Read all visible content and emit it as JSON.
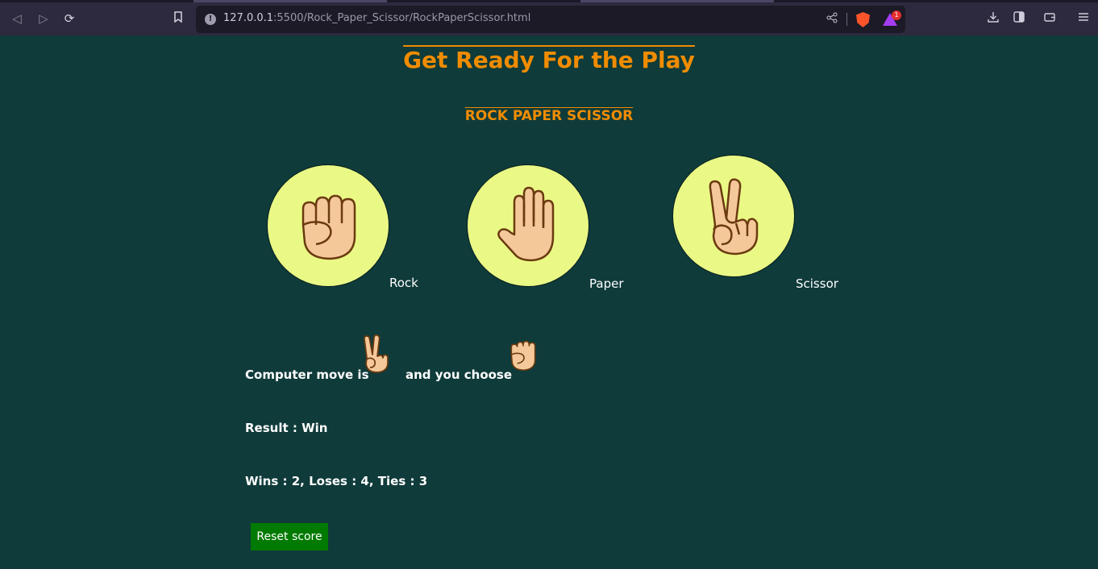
{
  "browser": {
    "url_host": "127.0.0.1",
    "url_path": ":5500/Rock_Paper_Scissor/RockPaperScissor.html"
  },
  "page": {
    "title": "Get Ready For the Play",
    "subtitle": "ROCK PAPER SCISSOR"
  },
  "choices": [
    {
      "label": "Rock",
      "icon": "fist-icon"
    },
    {
      "label": "Paper",
      "icon": "open-hand-icon"
    },
    {
      "label": "Scissor",
      "icon": "victory-hand-icon"
    }
  ],
  "result_panel": {
    "computer_move_label": "Computer move is",
    "computer_move_icon": "victory-hand-icon",
    "you_choose_label": "and you choose",
    "you_choose_icon": "fist-icon",
    "result_text": "Result : Win",
    "score_text": "Wins : 2, Loses : 4, Ties : 3"
  },
  "reset_button_label": "Reset score",
  "colors": {
    "background": "#0f3b3a",
    "heading": "#f08c00",
    "circle": "#eaf986",
    "reset_button": "#007a00"
  }
}
